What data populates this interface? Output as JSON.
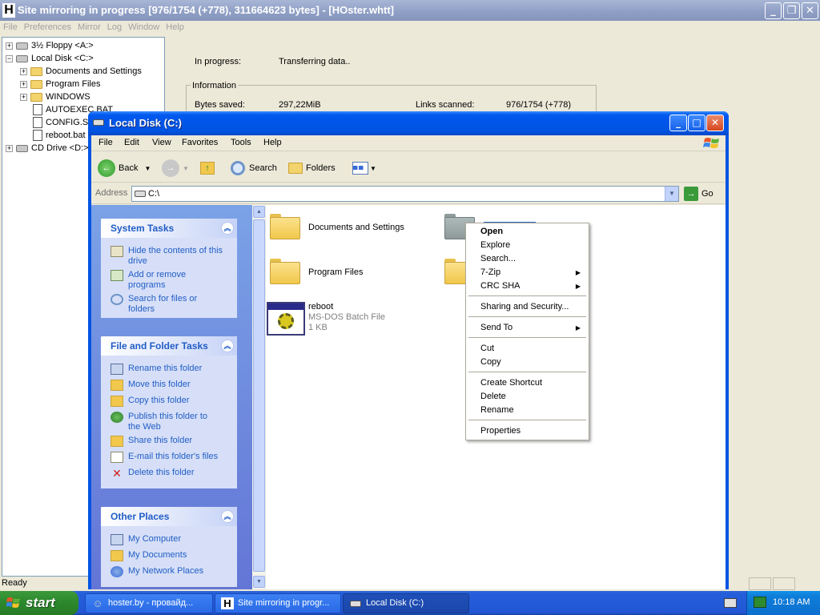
{
  "bg_window": {
    "title": "Site mirroring in progress [976/1754 (+778), 311664623 bytes] - [HOster.whtt]",
    "menu": [
      "File",
      "Preferences",
      "Mirror",
      "Log",
      "Window",
      "Help"
    ],
    "tree": [
      {
        "label": "3½ Floppy <A:>",
        "icon": "floppy-icon"
      },
      {
        "label": "Local Disk <C:>",
        "icon": "drive-icon"
      },
      {
        "label": "Documents and Settings",
        "icon": "folder-icon"
      },
      {
        "label": "Program Files",
        "icon": "folder-icon"
      },
      {
        "label": "WINDOWS",
        "icon": "folder-icon"
      },
      {
        "label": "AUTOEXEC.BAT",
        "icon": "file-icon"
      },
      {
        "label": "CONFIG.SYS",
        "icon": "file-icon"
      },
      {
        "label": "reboot.bat",
        "icon": "file-icon"
      },
      {
        "label": "CD Drive <D:>",
        "icon": "cd-icon"
      }
    ],
    "in_progress_label": "In progress:",
    "in_progress_value": "Transferring data..",
    "info_group": "Information",
    "bytes_saved_label": "Bytes saved:",
    "bytes_saved_value": "297,22MiB",
    "links_scanned_label": "Links scanned:",
    "links_scanned_value": "976/1754 (+778)",
    "status": "Ready"
  },
  "explorer": {
    "title": "Local Disk (C:)",
    "menu": [
      "File",
      "Edit",
      "View",
      "Favorites",
      "Tools",
      "Help"
    ],
    "toolbar": {
      "back": "Back",
      "search": "Search",
      "folders": "Folders"
    },
    "address_label": "Address",
    "address_value": "C:\\",
    "go_label": "Go",
    "system_tasks": {
      "title": "System Tasks",
      "links": [
        "Hide the contents of this drive",
        "Add or remove programs",
        "Search for files or folders"
      ]
    },
    "file_folder_tasks": {
      "title": "File and Folder Tasks",
      "links": [
        "Rename this folder",
        "Move this folder",
        "Copy this folder",
        "Publish this folder to the Web",
        "Share this folder",
        "E-mail this folder's files",
        "Delete this folder"
      ]
    },
    "other_places": {
      "title": "Other Places",
      "links": [
        "My Computer",
        "My Documents",
        "My Network Places"
      ]
    },
    "items": [
      {
        "name": "Documents and Settings"
      },
      {
        "name": "Program Files"
      },
      {
        "name": "reboot",
        "type": "MS-DOS Batch File",
        "size": "1 KB"
      }
    ]
  },
  "context_menu": [
    {
      "label": "Open",
      "bold": true
    },
    {
      "label": "Explore"
    },
    {
      "label": "Search..."
    },
    {
      "label": "7-Zip",
      "submenu": true
    },
    {
      "label": "CRC SHA",
      "submenu": true
    },
    {
      "label": "Sharing and Security..."
    },
    {
      "label": "Send To",
      "submenu": true
    },
    {
      "label": "Cut"
    },
    {
      "label": "Copy"
    },
    {
      "label": "Create Shortcut"
    },
    {
      "label": "Delete"
    },
    {
      "label": "Rename"
    },
    {
      "label": "Properties"
    }
  ],
  "taskbar": {
    "start": "start",
    "tasks": [
      "hoster.by - провайд...",
      "Site mirroring in progr...",
      "Local Disk (C:)"
    ],
    "clock": "10:18 AM"
  }
}
